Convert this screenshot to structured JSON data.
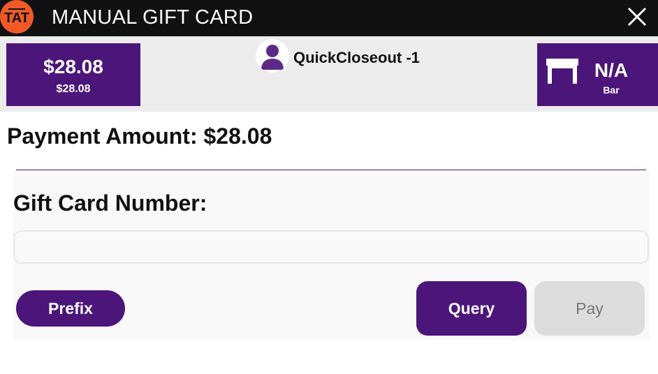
{
  "header": {
    "logo_text": "TAT",
    "title": "MANUAL GIFT CARD",
    "close_icon": "close-icon",
    "logo_color": "#f05a28"
  },
  "infobar": {
    "check_total": "$28.08",
    "check_subtotal": "$28.08",
    "server_name": "QuickCloseout -1",
    "table_number": "N/A",
    "table_area": "Bar"
  },
  "main": {
    "payment_amount_label": "Payment Amount: $28.08",
    "gift_card_label": "Gift Card Number:",
    "gift_card_value": "",
    "gift_card_placeholder": ""
  },
  "buttons": {
    "prefix": "Prefix",
    "query": "Query",
    "pay": "Pay"
  },
  "colors": {
    "accent": "#4b157a",
    "titlebar": "#111111",
    "disabled": "#dcdcdc"
  }
}
